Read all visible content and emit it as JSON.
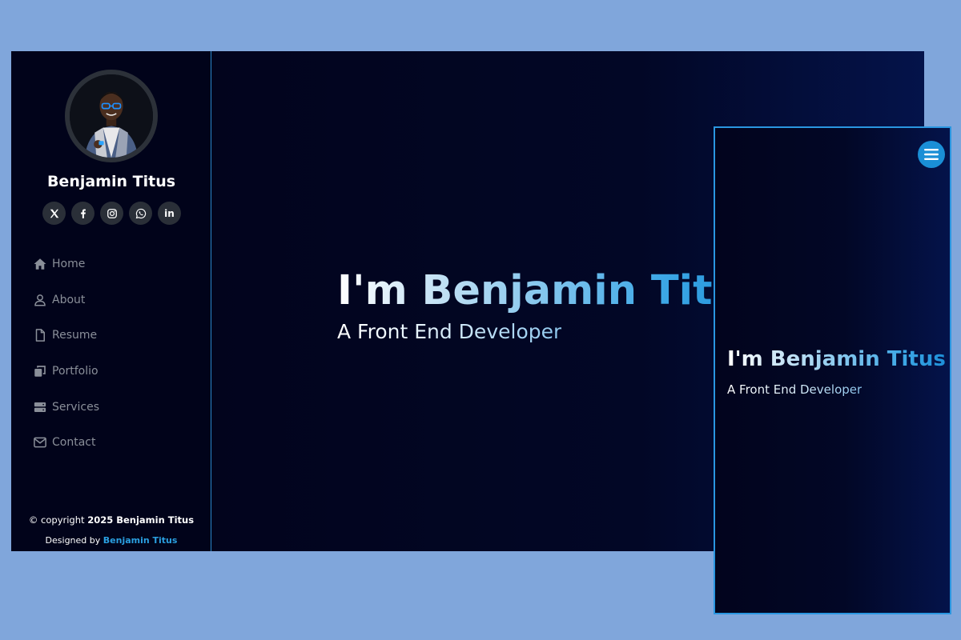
{
  "colors": {
    "page_background": "#80a6db",
    "sidebar_background": "#01031a",
    "hero_background": "#020726",
    "accent": "#1a8fd6",
    "nav_text": "#8a8f99"
  },
  "profile": {
    "name": "Benjamin Titus",
    "avatar_icon": "profile-photo"
  },
  "social": [
    {
      "name": "x-twitter",
      "glyph": "𝕏"
    },
    {
      "name": "facebook",
      "glyph": "f"
    },
    {
      "name": "instagram",
      "glyph": ""
    },
    {
      "name": "whatsapp",
      "glyph": ""
    },
    {
      "name": "linkedin",
      "glyph": "in"
    }
  ],
  "nav": {
    "items": [
      {
        "label": "Home",
        "icon": "home-icon",
        "active": true
      },
      {
        "label": "About",
        "icon": "user-icon",
        "active": false
      },
      {
        "label": "Resume",
        "icon": "file-icon",
        "active": false
      },
      {
        "label": "Portfolio",
        "icon": "copy-icon",
        "active": false
      },
      {
        "label": "Services",
        "icon": "server-icon",
        "active": false
      },
      {
        "label": "Contact",
        "icon": "envelope-icon",
        "active": false
      }
    ]
  },
  "footer": {
    "copyright_prefix": "© copyright ",
    "copyright_bold": "2025 Benjamin Titus",
    "designed_by": "Designed by ",
    "designer": "Benjamin Titus"
  },
  "hero": {
    "title": "I'm Benjamin Titus",
    "subtitle": "A Front End Developer"
  },
  "mobile": {
    "menu_icon": "hamburger-icon",
    "title": "I'm Benjamin Titus",
    "subtitle": "A Front End Developer"
  }
}
